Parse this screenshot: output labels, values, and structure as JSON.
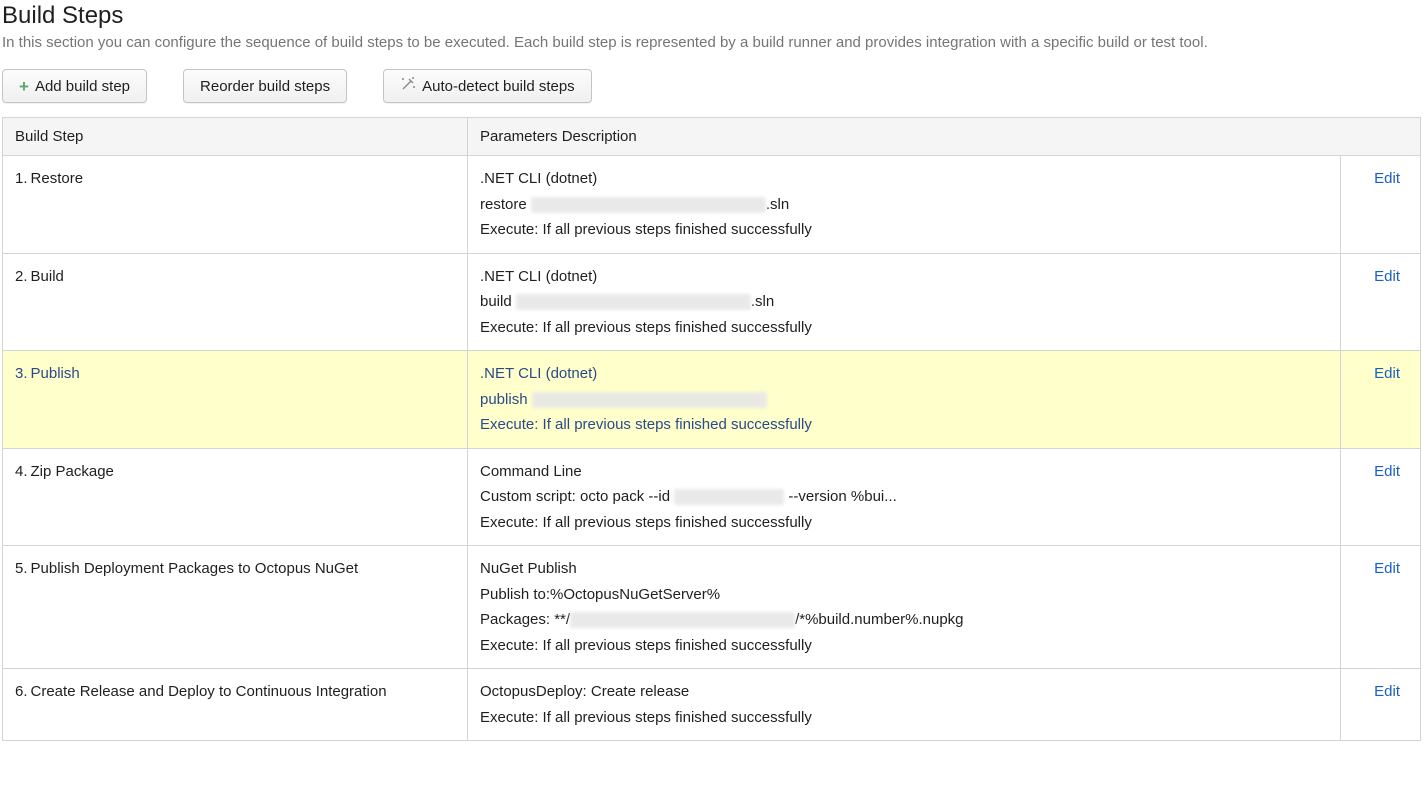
{
  "header": {
    "title": "Build Steps",
    "description": "In this section you can configure the sequence of build steps to be executed. Each build step is represented by a build runner and provides integration with a specific build or test tool."
  },
  "toolbar": {
    "add_label": "Add build step",
    "reorder_label": "Reorder build steps",
    "autodetect_label": "Auto-detect build steps"
  },
  "table": {
    "col_step": "Build Step",
    "col_params": "Parameters Description",
    "edit_label": "Edit"
  },
  "steps": [
    {
      "index": "1.",
      "title": "Restore",
      "highlighted": false,
      "params_html": ".NET CLI (dotnet)<br>restore <span class='redacted' style='width:235px'></span>.sln<br>Execute: If all previous steps finished successfully"
    },
    {
      "index": "2.",
      "title": "Build",
      "highlighted": false,
      "params_html": ".NET CLI (dotnet)<br>build <span class='redacted' style='width:235px'></span>.sln<br>Execute: If all previous steps finished successfully"
    },
    {
      "index": "3.",
      "title": "Publish",
      "highlighted": true,
      "params_html": ".NET CLI (dotnet)<br>publish <span class='redacted' style='width:235px'></span><br>Execute: If all previous steps finished successfully"
    },
    {
      "index": "4.",
      "title": "Zip Package",
      "highlighted": false,
      "params_html": "Command Line<br>Custom script: octo pack --id <span class='redacted' style='width:110px'></span> --version %bui...<br>Execute: If all previous steps finished successfully"
    },
    {
      "index": "5.",
      "title": "Publish Deployment Packages to Octopus NuGet",
      "highlighted": false,
      "params_html": "NuGet Publish<br>Publish to:%OctopusNuGetServer%<br>Packages: **/<span class='redacted' style='width:225px'></span>/*%build.number%.nupkg<br>Execute: If all previous steps finished successfully"
    },
    {
      "index": "6.",
      "title": "Create Release and Deploy to Continuous Integration",
      "highlighted": false,
      "params_html": "OctopusDeploy: Create release<br>Execute: If all previous steps finished successfully"
    }
  ]
}
